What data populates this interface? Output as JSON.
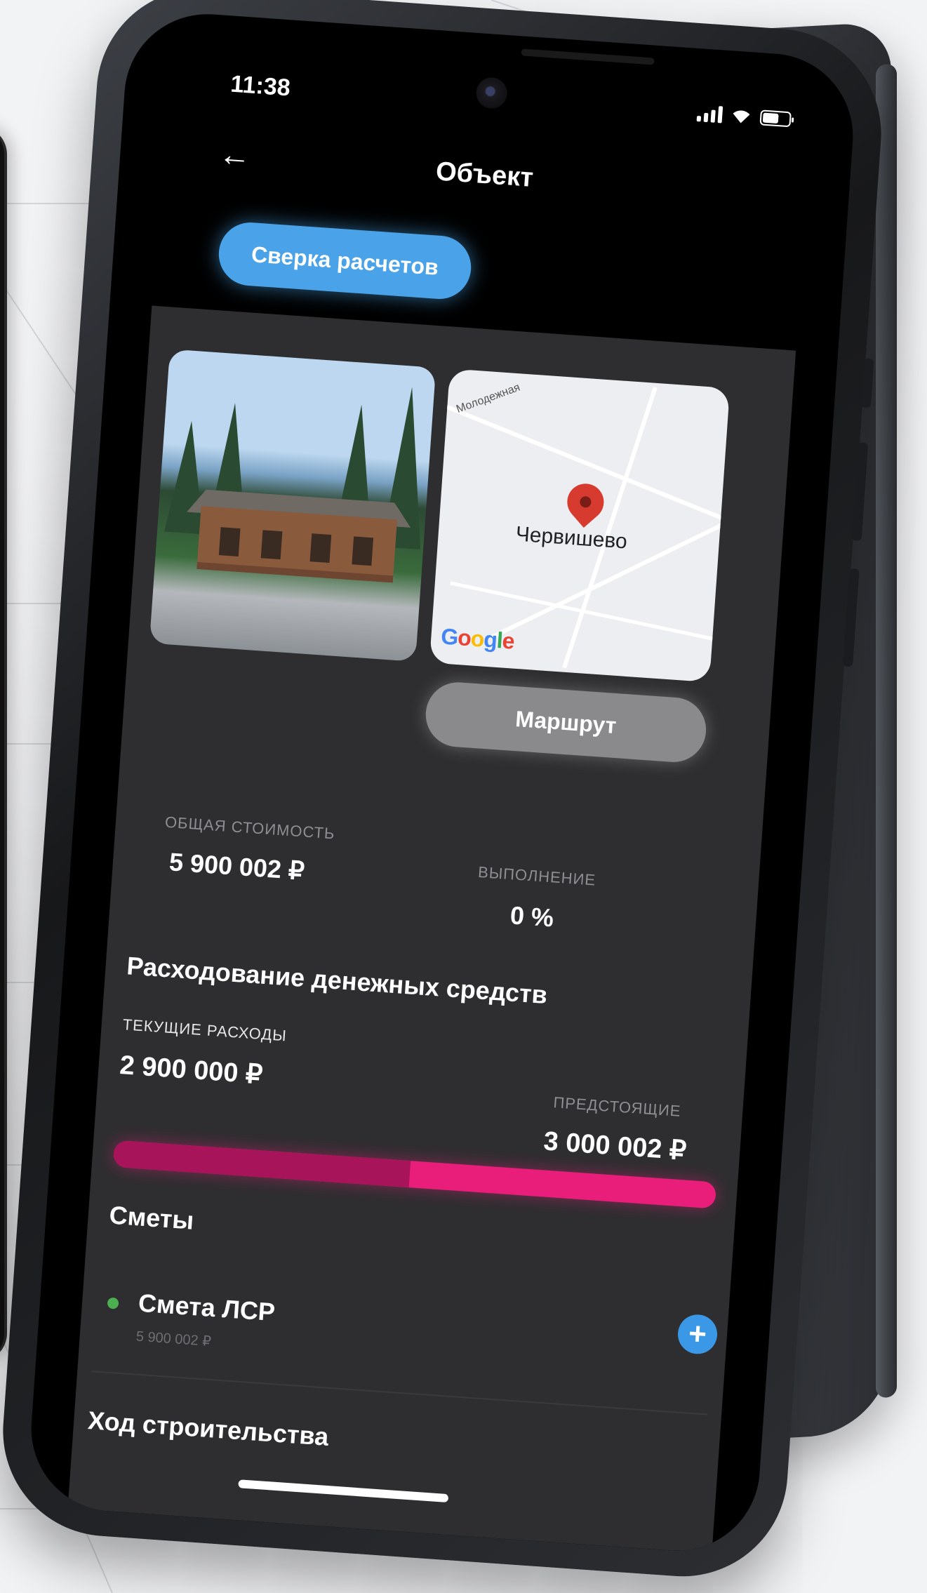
{
  "status_bar": {
    "time": "11:38"
  },
  "nav": {
    "title": "Объект"
  },
  "actions": {
    "reconcile_label": "Сверка расчетов",
    "route_label": "Маршрут"
  },
  "map": {
    "place_label": "Червишево",
    "street_label": "Молодежная",
    "provider": "Google"
  },
  "stats": {
    "total_cost_label": "ОБЩАЯ СТОИМОСТЬ",
    "total_cost_value": "5 900 002 ₽",
    "completion_label": "ВЫПОЛНЕНИЕ",
    "completion_value": "0 %"
  },
  "spending": {
    "title": "Расходование денежных средств",
    "current_label": "ТЕКУЩИЕ РАСХОДЫ",
    "current_value": "2 900 000 ₽",
    "upcoming_label": "ПРЕДСТОЯЩИЕ",
    "upcoming_value": "3 000 002 ₽",
    "spent_fraction": 0.4915
  },
  "estimates": {
    "title": "Сметы",
    "items": [
      {
        "name": "Смета ЛСР",
        "sum": "5 900 002 ₽",
        "status_color": "#4caf50"
      }
    ]
  },
  "construction": {
    "title": "Ход строительства"
  },
  "colors": {
    "accent": "#4aa3e8",
    "progress": "#e91e7a",
    "progress_spent": "#a8145a"
  }
}
